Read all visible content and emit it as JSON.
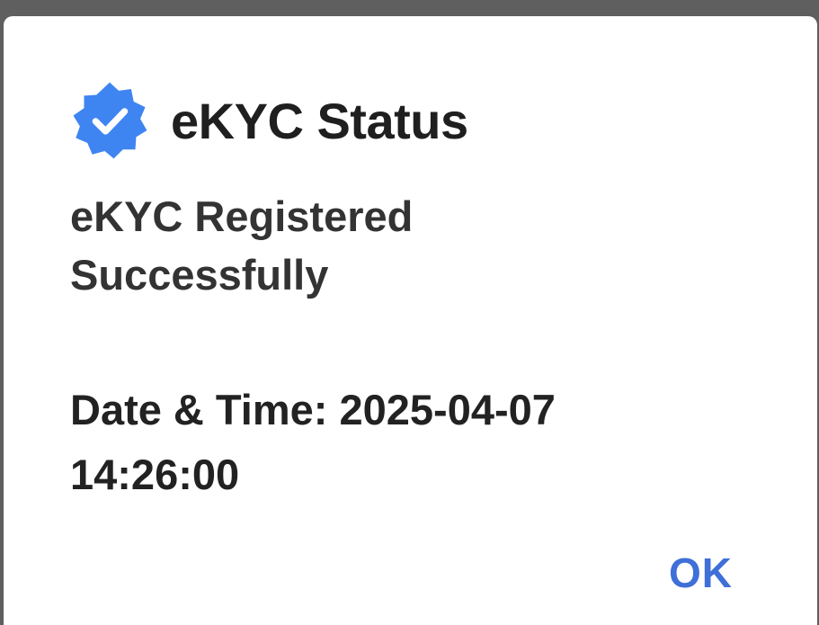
{
  "dialog": {
    "icon": "verified-badge-icon",
    "title": "eKYC Status",
    "message_line1": "eKYC Registered",
    "message_line2": "Successfully",
    "datetime_line1": "Date & Time: 2025-04-07",
    "datetime_line2": "14:26:00",
    "ok_label": "OK"
  },
  "colors": {
    "badge": "#3f85f2",
    "accent": "#3f6fd8",
    "text": "#222222",
    "background": "#ffffff",
    "backdrop": "#5f5f5f"
  }
}
